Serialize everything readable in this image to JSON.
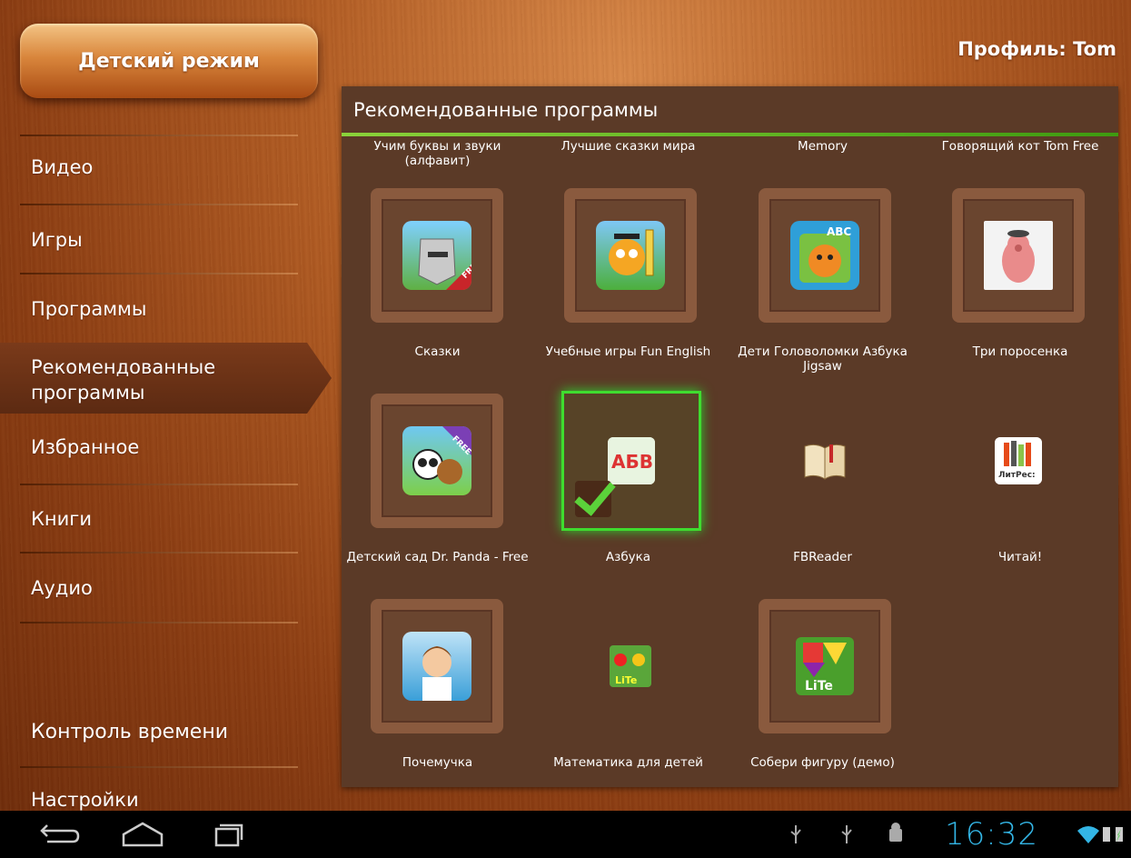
{
  "header": {
    "mode_button": "Детский режим",
    "profile": "Профиль: Tom"
  },
  "sidebar": {
    "items": [
      {
        "label": "Видео"
      },
      {
        "label": "Игры"
      },
      {
        "label": "Программы"
      },
      {
        "label": "Рекомендованные программы",
        "active": true
      },
      {
        "label": "Избранное"
      },
      {
        "label": "Книги"
      },
      {
        "label": "Аудио"
      }
    ],
    "time_control": "Контроль времени",
    "settings": "Настройки"
  },
  "panel": {
    "title": "Рекомендованные программы",
    "top_labels": [
      "Учим буквы и звуки (алфавит)",
      "Лучшие сказки мира",
      "Memory",
      "Говорящий кот Tom Free"
    ],
    "apps": [
      {
        "label": "Сказки",
        "icon": "knight-icon"
      },
      {
        "label": "Учебные игры Fun English",
        "icon": "owl-pencil-icon"
      },
      {
        "label": "Дети Головоломки Азбука Jigsaw",
        "icon": "abc-cat-puzzle-icon"
      },
      {
        "label": "Три поросенка",
        "icon": "pig-figure-icon"
      },
      {
        "label": "Детский сад Dr. Panda - Free",
        "icon": "panda-icon"
      },
      {
        "label": "Азбука",
        "icon": "abc-cube-icon",
        "selected": true
      },
      {
        "label": "FBReader",
        "icon": "book-icon"
      },
      {
        "label": "Читай!",
        "icon": "litres-icon"
      },
      {
        "label": "Почемучка",
        "icon": "boy-icon"
      },
      {
        "label": "Математика для детей",
        "icon": "fruit-math-icon"
      },
      {
        "label": "Собери фигуру (демо)",
        "icon": "shape-puzzle-icon"
      }
    ],
    "icon_texts": {
      "free": "FREE",
      "abc": "ABC",
      "ab": "АБВ",
      "lite": "LiTe",
      "litres": "ЛитРес:"
    }
  },
  "statusbar": {
    "time": "16:32"
  }
}
